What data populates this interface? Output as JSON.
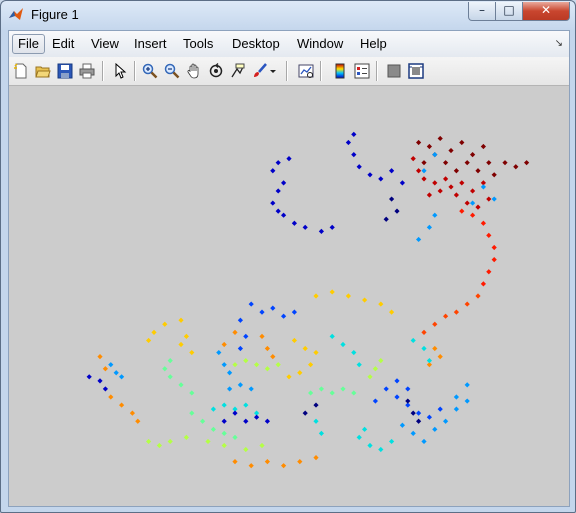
{
  "window": {
    "title": "Figure 1"
  },
  "caption": {
    "minimize": "–",
    "maximize": "□",
    "close": "✕"
  },
  "menu": {
    "items": [
      {
        "label": "File",
        "key": "file"
      },
      {
        "label": "Edit",
        "key": "edit"
      },
      {
        "label": "View",
        "key": "view"
      },
      {
        "label": "Insert",
        "key": "insert"
      },
      {
        "label": "Tools",
        "key": "tools"
      },
      {
        "label": "Desktop",
        "key": "desktop"
      },
      {
        "label": "Window",
        "key": "window"
      },
      {
        "label": "Help",
        "key": "help"
      }
    ],
    "dock_arrow": "↘"
  },
  "toolbar": {
    "icons": [
      "new-figure-icon",
      "open-file-icon",
      "save-icon",
      "print-icon",
      "pointer-icon",
      "zoom-in-icon",
      "zoom-out-icon",
      "pan-hand-icon",
      "rotate-3d-icon",
      "data-cursor-icon",
      "brush-icon",
      "brush-dropdown-icon",
      "link-plot-icon",
      "colorbar-icon",
      "legend-icon",
      "hide-plot-tools-icon",
      "show-plot-tools-icon"
    ]
  },
  "chart_data": {
    "type": "scatter",
    "title": "",
    "xlabel": "",
    "ylabel": "",
    "axes_visible": false,
    "colormap": "jet",
    "series": [
      {
        "color": "#7f0000",
        "points": [
          [
            0.74,
            0.12
          ],
          [
            0.76,
            0.13
          ],
          [
            0.78,
            0.11
          ],
          [
            0.8,
            0.14
          ],
          [
            0.82,
            0.12
          ],
          [
            0.84,
            0.15
          ],
          [
            0.86,
            0.13
          ],
          [
            0.87,
            0.17
          ],
          [
            0.85,
            0.19
          ],
          [
            0.83,
            0.17
          ],
          [
            0.81,
            0.19
          ],
          [
            0.79,
            0.17
          ],
          [
            0.77,
            0.15
          ],
          [
            0.75,
            0.17
          ],
          [
            0.88,
            0.2
          ],
          [
            0.9,
            0.17
          ],
          [
            0.92,
            0.18
          ],
          [
            0.94,
            0.17
          ]
        ]
      },
      {
        "color": "#c00000",
        "points": [
          [
            0.73,
            0.16
          ],
          [
            0.74,
            0.19
          ],
          [
            0.75,
            0.21
          ],
          [
            0.77,
            0.22
          ],
          [
            0.79,
            0.21
          ],
          [
            0.8,
            0.23
          ],
          [
            0.82,
            0.22
          ],
          [
            0.84,
            0.24
          ],
          [
            0.86,
            0.22
          ],
          [
            0.83,
            0.27
          ],
          [
            0.81,
            0.25
          ],
          [
            0.78,
            0.24
          ],
          [
            0.76,
            0.25
          ],
          [
            0.85,
            0.28
          ],
          [
            0.87,
            0.26
          ]
        ]
      },
      {
        "color": "#ff1a00",
        "points": [
          [
            0.82,
            0.29
          ],
          [
            0.84,
            0.3
          ],
          [
            0.86,
            0.32
          ],
          [
            0.87,
            0.35
          ],
          [
            0.88,
            0.38
          ],
          [
            0.88,
            0.41
          ],
          [
            0.87,
            0.44
          ],
          [
            0.86,
            0.47
          ]
        ]
      },
      {
        "color": "#ff4400",
        "points": [
          [
            0.85,
            0.5
          ],
          [
            0.83,
            0.52
          ],
          [
            0.81,
            0.54
          ],
          [
            0.79,
            0.55
          ],
          [
            0.77,
            0.57
          ],
          [
            0.75,
            0.59
          ]
        ]
      },
      {
        "color": "#ff8c00",
        "points": [
          [
            0.77,
            0.63
          ],
          [
            0.78,
            0.65
          ],
          [
            0.76,
            0.67
          ],
          [
            0.45,
            0.6
          ],
          [
            0.46,
            0.63
          ],
          [
            0.47,
            0.65
          ],
          [
            0.4,
            0.59
          ],
          [
            0.38,
            0.62
          ],
          [
            0.17,
            0.75
          ],
          [
            0.19,
            0.77
          ],
          [
            0.21,
            0.79
          ],
          [
            0.22,
            0.81
          ],
          [
            0.4,
            0.91
          ],
          [
            0.43,
            0.92
          ],
          [
            0.46,
            0.91
          ],
          [
            0.49,
            0.92
          ],
          [
            0.52,
            0.91
          ],
          [
            0.55,
            0.9
          ],
          [
            0.15,
            0.65
          ],
          [
            0.16,
            0.68
          ]
        ]
      },
      {
        "color": "#ffcc00",
        "points": [
          [
            0.31,
            0.6
          ],
          [
            0.3,
            0.62
          ],
          [
            0.32,
            0.64
          ],
          [
            0.51,
            0.61
          ],
          [
            0.53,
            0.63
          ],
          [
            0.55,
            0.64
          ],
          [
            0.54,
            0.67
          ],
          [
            0.52,
            0.69
          ],
          [
            0.5,
            0.7
          ],
          [
            0.55,
            0.5
          ],
          [
            0.58,
            0.49
          ],
          [
            0.61,
            0.5
          ],
          [
            0.64,
            0.51
          ],
          [
            0.67,
            0.52
          ],
          [
            0.69,
            0.54
          ],
          [
            0.24,
            0.61
          ],
          [
            0.25,
            0.59
          ],
          [
            0.27,
            0.57
          ],
          [
            0.3,
            0.56
          ]
        ]
      },
      {
        "color": "#b4ff46",
        "points": [
          [
            0.4,
            0.67
          ],
          [
            0.42,
            0.66
          ],
          [
            0.44,
            0.67
          ],
          [
            0.46,
            0.68
          ],
          [
            0.48,
            0.67
          ],
          [
            0.67,
            0.66
          ],
          [
            0.66,
            0.68
          ],
          [
            0.65,
            0.7
          ],
          [
            0.24,
            0.86
          ],
          [
            0.26,
            0.87
          ],
          [
            0.28,
            0.86
          ],
          [
            0.31,
            0.85
          ],
          [
            0.35,
            0.86
          ],
          [
            0.38,
            0.87
          ],
          [
            0.42,
            0.88
          ],
          [
            0.45,
            0.87
          ]
        ]
      },
      {
        "color": "#66ff99",
        "points": [
          [
            0.28,
            0.66
          ],
          [
            0.27,
            0.68
          ],
          [
            0.28,
            0.7
          ],
          [
            0.3,
            0.72
          ],
          [
            0.32,
            0.74
          ],
          [
            0.54,
            0.74
          ],
          [
            0.56,
            0.73
          ],
          [
            0.58,
            0.74
          ],
          [
            0.6,
            0.73
          ],
          [
            0.62,
            0.74
          ],
          [
            0.32,
            0.79
          ],
          [
            0.34,
            0.81
          ],
          [
            0.36,
            0.83
          ],
          [
            0.38,
            0.84
          ],
          [
            0.4,
            0.85
          ]
        ]
      },
      {
        "color": "#00e0e0",
        "points": [
          [
            0.38,
            0.77
          ],
          [
            0.4,
            0.78
          ],
          [
            0.42,
            0.77
          ],
          [
            0.44,
            0.79
          ],
          [
            0.58,
            0.6
          ],
          [
            0.6,
            0.62
          ],
          [
            0.62,
            0.64
          ],
          [
            0.63,
            0.67
          ],
          [
            0.73,
            0.61
          ],
          [
            0.75,
            0.63
          ],
          [
            0.76,
            0.66
          ],
          [
            0.65,
            0.87
          ],
          [
            0.67,
            0.88
          ],
          [
            0.69,
            0.86
          ],
          [
            0.64,
            0.83
          ],
          [
            0.63,
            0.85
          ],
          [
            0.36,
            0.78
          ],
          [
            0.55,
            0.81
          ],
          [
            0.56,
            0.84
          ]
        ]
      },
      {
        "color": "#0099ff",
        "points": [
          [
            0.17,
            0.67
          ],
          [
            0.18,
            0.69
          ],
          [
            0.19,
            0.7
          ],
          [
            0.39,
            0.73
          ],
          [
            0.41,
            0.72
          ],
          [
            0.43,
            0.73
          ],
          [
            0.37,
            0.64
          ],
          [
            0.38,
            0.67
          ],
          [
            0.39,
            0.69
          ],
          [
            0.71,
            0.82
          ],
          [
            0.73,
            0.84
          ],
          [
            0.75,
            0.86
          ],
          [
            0.77,
            0.83
          ],
          [
            0.79,
            0.81
          ],
          [
            0.81,
            0.78
          ],
          [
            0.83,
            0.76
          ],
          [
            0.77,
            0.15
          ],
          [
            0.75,
            0.19
          ],
          [
            0.77,
            0.3
          ],
          [
            0.76,
            0.33
          ],
          [
            0.74,
            0.36
          ],
          [
            0.86,
            0.23
          ],
          [
            0.88,
            0.26
          ],
          [
            0.84,
            0.27
          ],
          [
            0.83,
            0.72
          ],
          [
            0.81,
            0.75
          ]
        ]
      },
      {
        "color": "#0044ff",
        "points": [
          [
            0.43,
            0.52
          ],
          [
            0.45,
            0.54
          ],
          [
            0.47,
            0.53
          ],
          [
            0.49,
            0.55
          ],
          [
            0.51,
            0.54
          ],
          [
            0.41,
            0.56
          ],
          [
            0.42,
            0.6
          ],
          [
            0.41,
            0.63
          ],
          [
            0.7,
            0.75
          ],
          [
            0.72,
            0.77
          ],
          [
            0.74,
            0.79
          ],
          [
            0.76,
            0.8
          ],
          [
            0.78,
            0.78
          ],
          [
            0.72,
            0.73
          ],
          [
            0.7,
            0.71
          ],
          [
            0.68,
            0.73
          ],
          [
            0.66,
            0.76
          ]
        ]
      },
      {
        "color": "#0000c8",
        "points": [
          [
            0.49,
            0.22
          ],
          [
            0.48,
            0.24
          ],
          [
            0.47,
            0.27
          ],
          [
            0.48,
            0.29
          ],
          [
            0.49,
            0.3
          ],
          [
            0.51,
            0.32
          ],
          [
            0.53,
            0.33
          ],
          [
            0.56,
            0.34
          ],
          [
            0.58,
            0.33
          ],
          [
            0.47,
            0.19
          ],
          [
            0.48,
            0.17
          ],
          [
            0.5,
            0.16
          ],
          [
            0.13,
            0.7
          ],
          [
            0.15,
            0.71
          ],
          [
            0.16,
            0.73
          ],
          [
            0.4,
            0.79
          ],
          [
            0.42,
            0.81
          ],
          [
            0.44,
            0.8
          ],
          [
            0.46,
            0.81
          ],
          [
            0.38,
            0.81
          ],
          [
            0.62,
            0.1
          ],
          [
            0.61,
            0.12
          ],
          [
            0.62,
            0.15
          ],
          [
            0.63,
            0.18
          ],
          [
            0.65,
            0.2
          ],
          [
            0.67,
            0.21
          ],
          [
            0.69,
            0.19
          ],
          [
            0.71,
            0.22
          ]
        ]
      },
      {
        "color": "#00007f",
        "points": [
          [
            0.73,
            0.79
          ],
          [
            0.74,
            0.81
          ],
          [
            0.72,
            0.76
          ],
          [
            0.53,
            0.79
          ],
          [
            0.55,
            0.77
          ],
          [
            0.68,
            0.31
          ],
          [
            0.7,
            0.29
          ],
          [
            0.69,
            0.26
          ]
        ]
      }
    ]
  }
}
